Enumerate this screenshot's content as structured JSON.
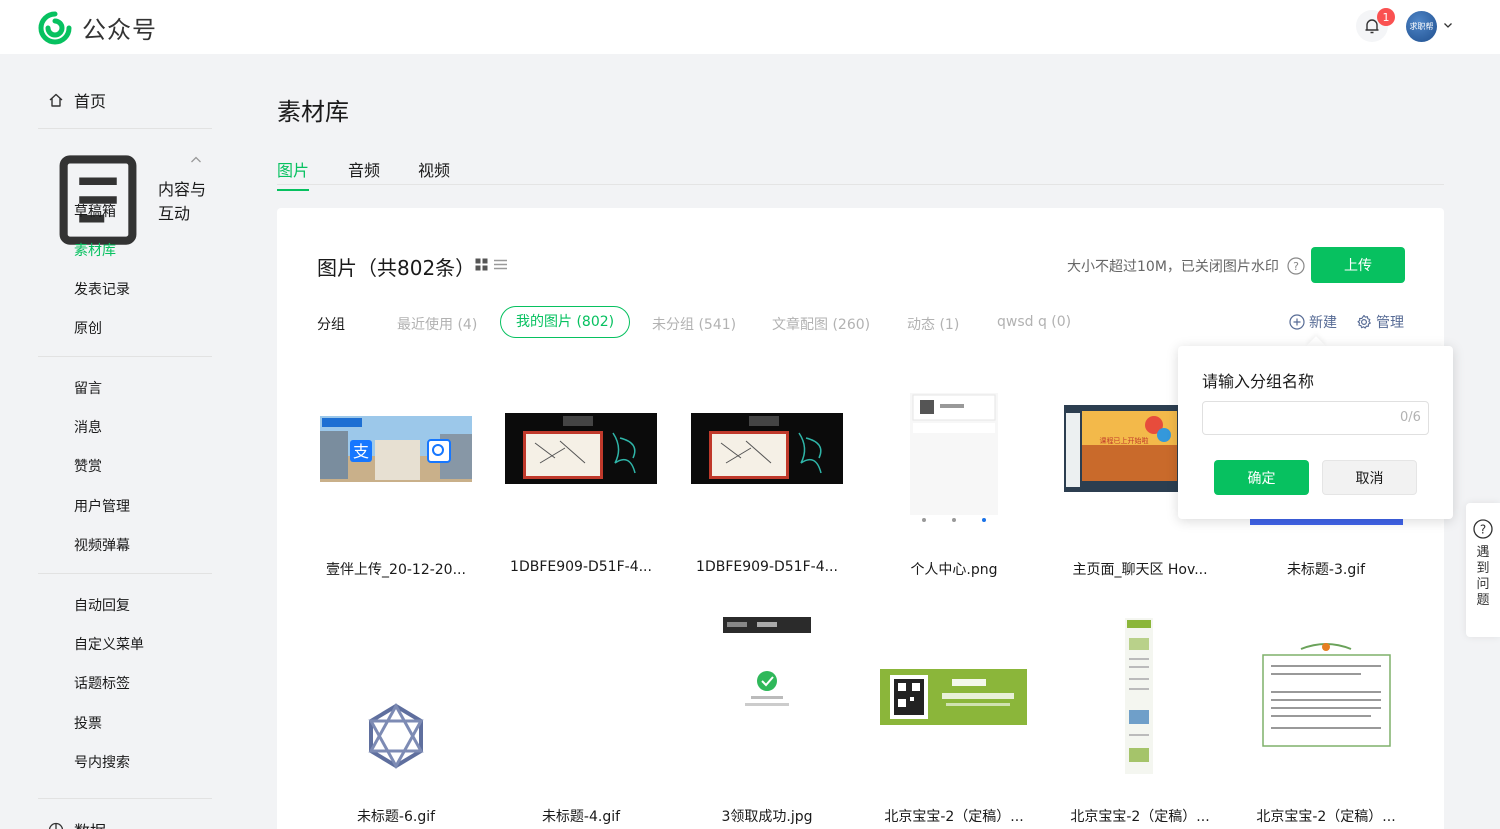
{
  "app": {
    "name": "公众号",
    "notification_count": "1",
    "avatar_text": "求职帮"
  },
  "sidebar": {
    "home": "首页",
    "content_group": "内容与互动",
    "content_items": [
      "草稿箱",
      "素材库",
      "发表记录",
      "原创"
    ],
    "interaction_items": [
      "留言",
      "消息",
      "赞赏",
      "用户管理",
      "视频弹幕"
    ],
    "tool_items": [
      "自动回复",
      "自定义菜单",
      "话题标签",
      "投票",
      "号内搜索"
    ],
    "data_group": "数据"
  },
  "main": {
    "title": "素材库",
    "tabs": [
      "图片",
      "音频",
      "视频"
    ]
  },
  "card": {
    "title": "图片（共802条）",
    "hint": "大小不超过10M，已关闭图片水印",
    "upload": "上传",
    "group_label": "分组",
    "groups": [
      "最近使用 (4)",
      "我的图片 (802)",
      "未分组 (541)",
      "文章配图 (260)",
      "动态 (1)",
      "qwsd q (0)"
    ],
    "new_group": "新建",
    "manage": "管理"
  },
  "images": [
    "壹伴上传_20-12-20...",
    "1DBFE909-D51F-4...",
    "1DBFE909-D51F-4...",
    "个人中心.png",
    "主页面_聊天区 Hov...",
    "未标题-3.gif",
    "未标题-6.gif",
    "未标题-4.gif",
    "3领取成功.jpg",
    "北京宝宝-2（定稿）...",
    "北京宝宝-2（定稿）...",
    "北京宝宝-2（定稿）..."
  ],
  "popup": {
    "title": "请输入分组名称",
    "value": "",
    "count": "0/6",
    "confirm": "确定",
    "cancel": "取消"
  },
  "help": {
    "text": "遇到问题"
  },
  "colors": {
    "brand": "#07c160",
    "link": "#576b95",
    "badge": "#fa5151"
  }
}
